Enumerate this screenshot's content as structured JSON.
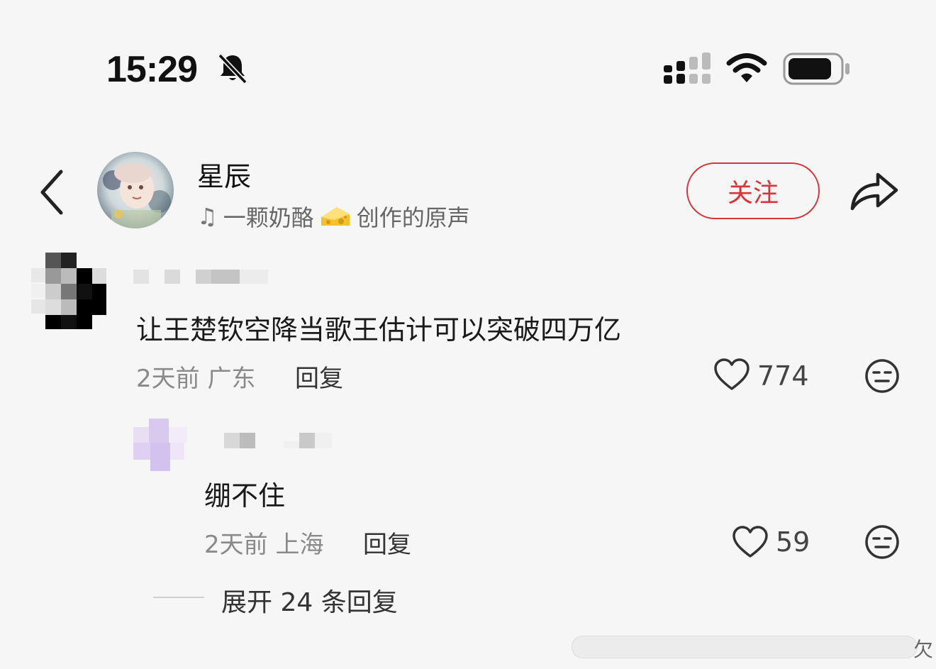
{
  "status_bar": {
    "time": "15:29",
    "icons": [
      "bell-muted-icon",
      "signal-icon",
      "wifi-icon",
      "battery-icon"
    ]
  },
  "header": {
    "username": "星辰",
    "music_prefix": "一颗奶酪",
    "music_suffix": "创作的原声",
    "follow_label": "关注",
    "accent_color": "#d9343a"
  },
  "comments": [
    {
      "text": "让王楚钦空降当歌王估计可以突破四万亿",
      "meta": "2天前 广东",
      "reply_label": "回复",
      "likes": "774"
    },
    {
      "text": "绷不住",
      "meta": "2天前 上海",
      "reply_label": "回复",
      "likes": "59"
    }
  ],
  "expand_label": "展开 24 条回复",
  "corner_glyph": "欠"
}
